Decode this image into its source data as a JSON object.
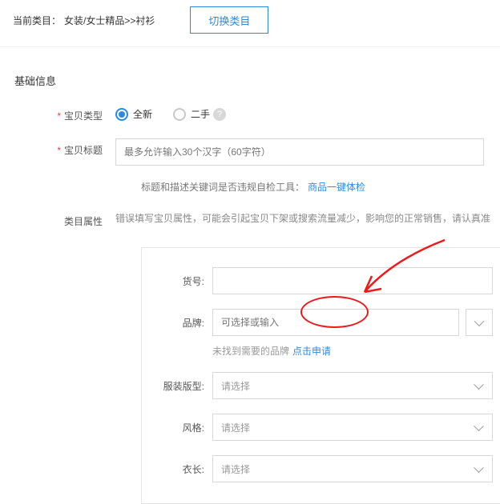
{
  "topbar": {
    "label": "当前类目：",
    "path": "女装/女士精品>>衬衫",
    "switch_btn": "切换类目"
  },
  "section_title": "基础信息",
  "form": {
    "item_type": {
      "label": "宝贝类型",
      "opts": {
        "new": "全新",
        "used": "二手"
      }
    },
    "title": {
      "label": "宝贝标题",
      "placeholder": "最多允许输入30个汉字（60字符）",
      "hint_prefix": "标题和描述关键词是否违规自检工具：",
      "hint_link": "商品一键体检"
    },
    "category_attr": {
      "label": "类目属性",
      "warning": "错误填写宝贝属性，可能会引起宝贝下架或搜索流量减少，影响您的正常销售，请认真准"
    }
  },
  "attrs": {
    "sku": {
      "label": "货号:"
    },
    "brand": {
      "label": "品牌:",
      "placeholder": "可选择或输入",
      "hint_prefix": "未找到需要的品牌",
      "hint_link": "点击申请"
    },
    "fit": {
      "label": "服装版型:",
      "placeholder": "请选择"
    },
    "style": {
      "label": "风格:",
      "placeholder": "请选择"
    },
    "length": {
      "label": "衣长:",
      "placeholder": "请选择"
    }
  }
}
